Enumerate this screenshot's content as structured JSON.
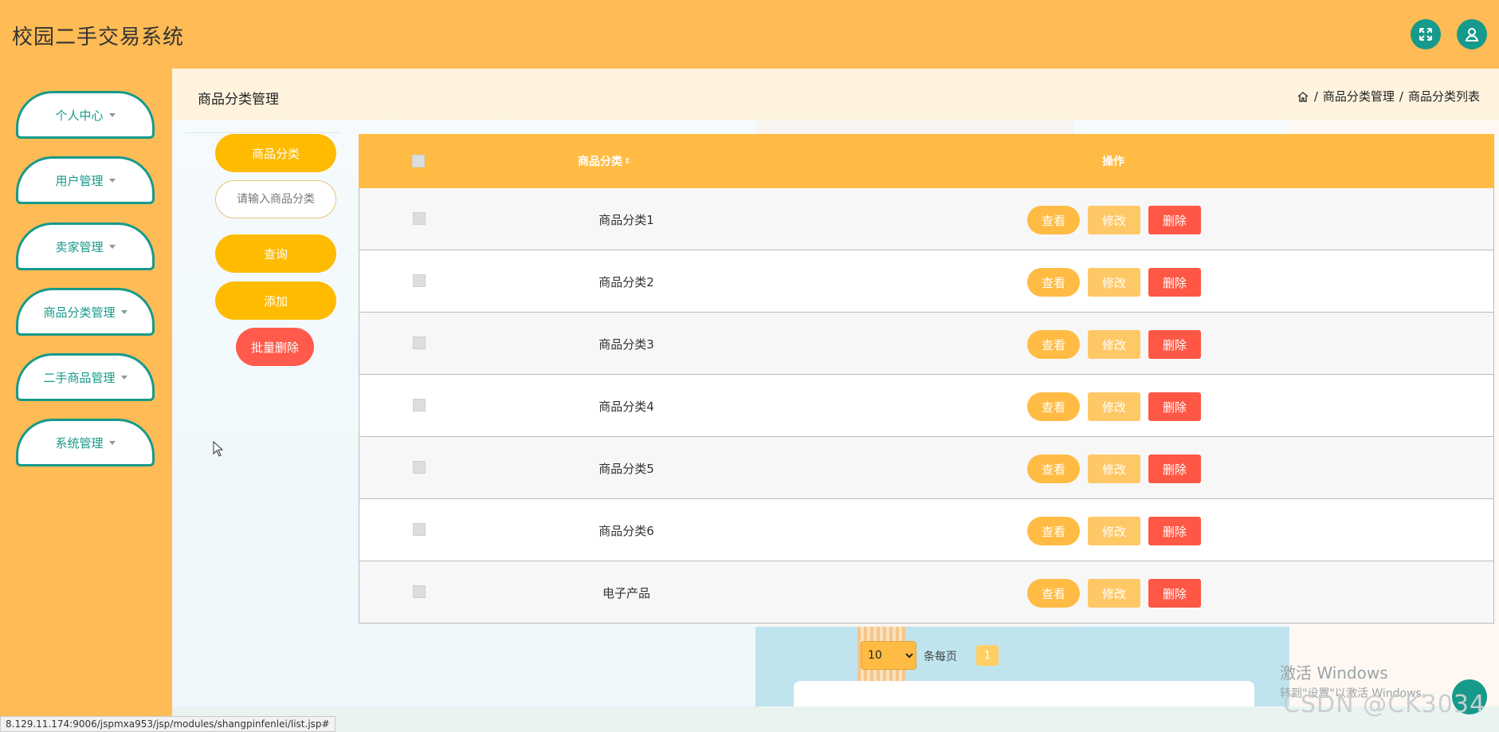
{
  "app": {
    "title": "校园二手交易系统"
  },
  "header": {
    "icons": [
      "fullscreen-icon",
      "user-icon"
    ],
    "accent": "#169a8b",
    "bg": "#ffbb55"
  },
  "sidebar": {
    "items": [
      {
        "label": "个人中心"
      },
      {
        "label": "用户管理"
      },
      {
        "label": "卖家管理"
      },
      {
        "label": "商品分类管理"
      },
      {
        "label": "二手商品管理"
      },
      {
        "label": "系统管理"
      }
    ]
  },
  "page": {
    "title": "商品分类管理",
    "breadcrumb": [
      "商品分类管理",
      "商品分类列表"
    ],
    "breadcrumb_sep": "/"
  },
  "search": {
    "label": "商品分类",
    "placeholder": "请输入商品分类",
    "query_label": "查询",
    "add_label": "添加",
    "batch_delete_label": "批量删除"
  },
  "table": {
    "columns": [
      "商品分类",
      "操作"
    ],
    "sort_glyph": "⇕",
    "rows": [
      {
        "name": "商品分类1"
      },
      {
        "name": "商品分类2"
      },
      {
        "name": "商品分类3"
      },
      {
        "name": "商品分类4"
      },
      {
        "name": "商品分类5"
      },
      {
        "name": "商品分类6"
      },
      {
        "name": "电子产品"
      }
    ],
    "actions": {
      "view": "查看",
      "edit": "修改",
      "delete": "删除"
    }
  },
  "pager": {
    "page_size": "10",
    "per_page_label": "条每页",
    "current": "1"
  },
  "watermark": {
    "line1": "激活 Windows",
    "line2": "转到\"设置\"以激活 Windows。",
    "csdn": "CSDN @CK3034"
  },
  "status_url": "8.129.11.174:9006/jspmxa953/jsp/modules/shangpinfenlei/list.jsp#"
}
